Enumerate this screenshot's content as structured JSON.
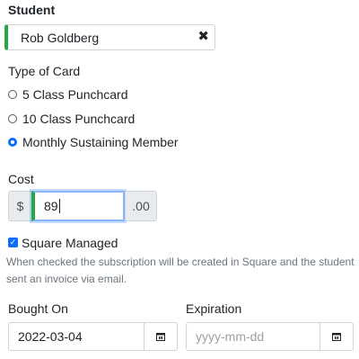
{
  "student": {
    "label": "Student",
    "value": "Rob Goldberg",
    "clear": "✖"
  },
  "card_type": {
    "label": "Type of Card",
    "options": [
      {
        "label": "5 Class Punchcard",
        "selected": false
      },
      {
        "label": "10 Class Punchcard",
        "selected": false
      },
      {
        "label": "Monthly Sustaining Member",
        "selected": true
      }
    ]
  },
  "cost": {
    "label": "Cost",
    "prefix": "$",
    "value": "89",
    "suffix": ".00"
  },
  "square": {
    "label": "Square Managed",
    "checked": true,
    "help_line1": "When checked the subscription will be created in Square and the student",
    "help_line2": "sent an invoice via email."
  },
  "bought_on": {
    "label": "Bought On",
    "value": "2022-03-04"
  },
  "expiration": {
    "label": "Expiration",
    "placeholder": "yyyy-mm-dd"
  },
  "colors": {
    "accent_green": "#28a745",
    "primary_blue": "#0d6efd",
    "help_gray": "#6c757d"
  }
}
